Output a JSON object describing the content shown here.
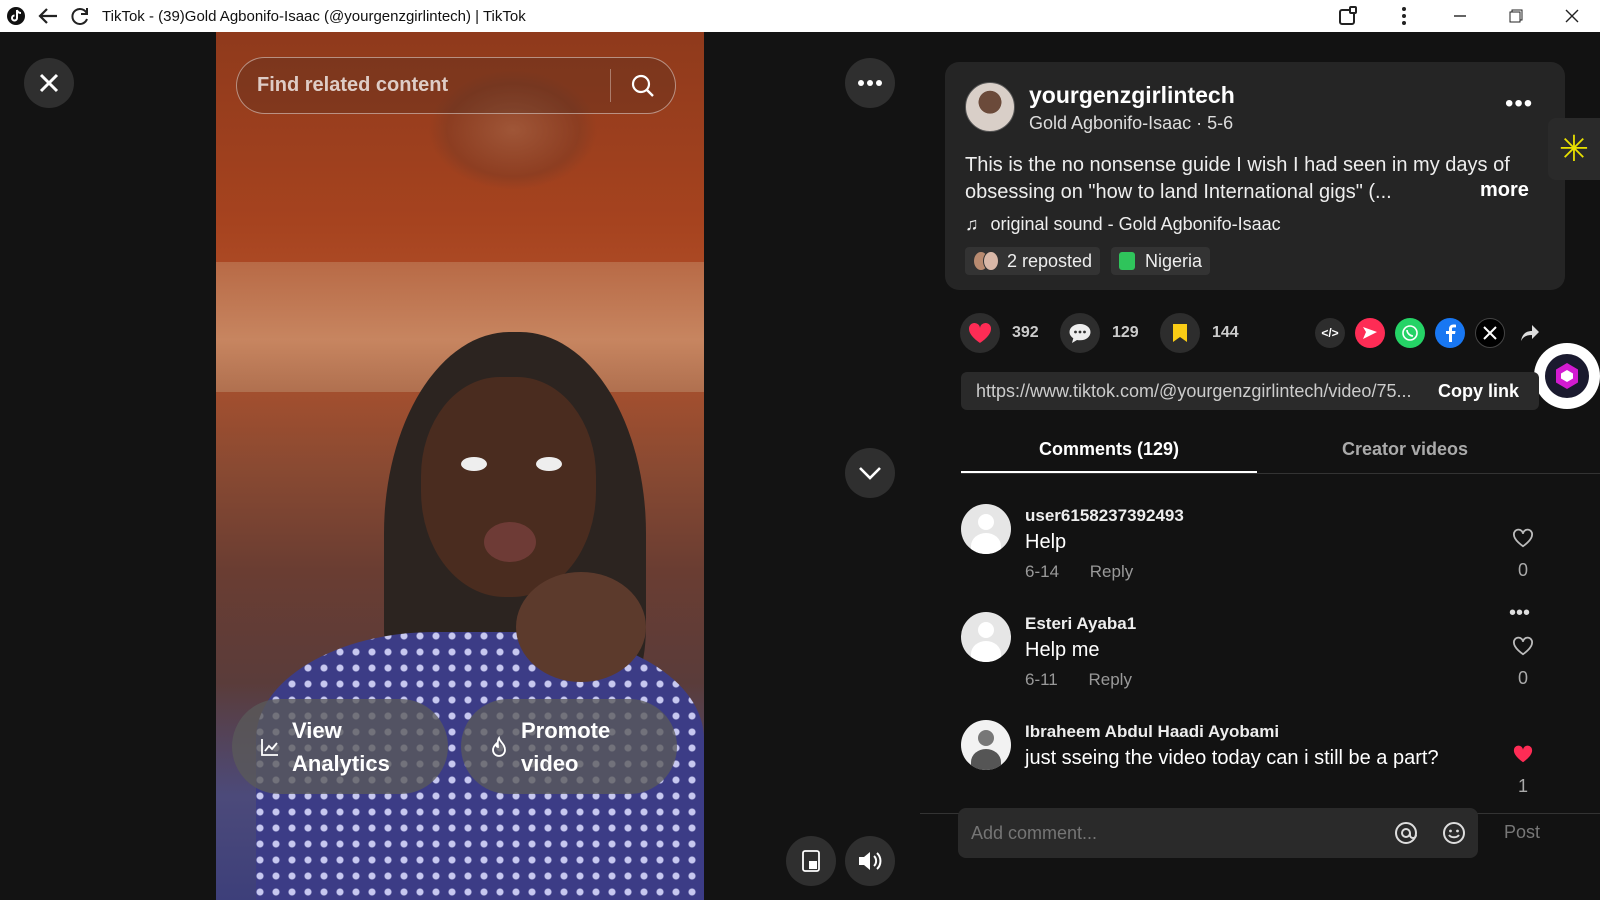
{
  "window": {
    "title": "TikTok - (39)Gold Agbonifo-Isaac (@yourgenzgirlintech) | TikTok",
    "icons": [
      "tiktok-icon",
      "back-icon",
      "reload-icon",
      "extensions-icon",
      "menu-icon",
      "minimize-icon",
      "restore-icon",
      "close-icon"
    ]
  },
  "video": {
    "search_placeholder": "Find related content",
    "analytics_label": "View Analytics",
    "promote_label": "Promote video"
  },
  "post": {
    "username": "yourgenzgirlintech",
    "nickname_date": "Gold Agbonifo-Isaac · 5-6",
    "description": "This is the no nonsense guide I wish I had seen in my days of obsessing on \"how to land International gigs\" (...",
    "more_label": "more",
    "sound": "original sound - Gold Agbonifo-Isaac",
    "reposted": "2 reposted",
    "location": "Nigeria",
    "likes": "392",
    "comments": "129",
    "saves": "144",
    "link": "https://www.tiktok.com/@yourgenzgirlintech/video/75...",
    "copy_link_label": "Copy link",
    "colors": {
      "like": "#fe2c55",
      "save": "#facc15",
      "whatsapp": "#25d366",
      "facebook": "#1877f2"
    }
  },
  "tabs": [
    {
      "label": "Comments (129)",
      "active": true
    },
    {
      "label": "Creator videos",
      "active": false
    }
  ],
  "comments": [
    {
      "user": "user6158237392493",
      "text": "Help",
      "date": "6-14",
      "reply": "Reply",
      "likes": "0",
      "liked": false
    },
    {
      "user": "Esteri Ayaba1",
      "text": "Help me",
      "date": "6-11",
      "reply": "Reply",
      "likes": "0",
      "liked": false
    },
    {
      "user": "Ibraheem Abdul Haadi Ayobami",
      "text": "just sseing the video today can i still be a part?",
      "date": "",
      "reply": "",
      "likes": "1",
      "liked": true
    }
  ],
  "composer": {
    "placeholder": "Add comment...",
    "post_label": "Post"
  }
}
